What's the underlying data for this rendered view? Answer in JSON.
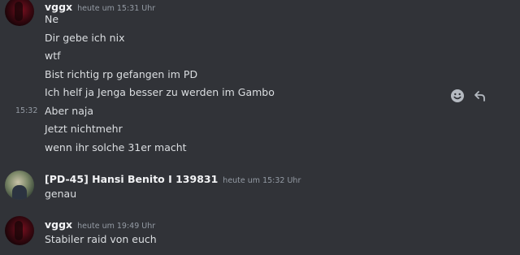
{
  "groups": [
    {
      "username": "vggx",
      "timestamp": "heute um 15:31 Uhr",
      "messages": [
        "Ne",
        "Dir gebe ich nix",
        "wtf",
        "Bist richtig rp gefangen im PD",
        "Ich helf ja Jenga besser zu werden im Gambo",
        "Aber naja",
        "Jetzt nichtmehr",
        "wenn ihr solche 31er macht"
      ],
      "hover_timestamp": "15:32"
    },
    {
      "username": "[PD-45] Hansi Benito I 139831",
      "timestamp": "heute um 15:32 Uhr",
      "messages": [
        "genau"
      ]
    },
    {
      "username": "vggx",
      "timestamp": "heute um 19:49 Uhr",
      "messages": [
        "Stabiler raid von euch"
      ]
    }
  ],
  "colors": {
    "background": "#313338",
    "text": "#dbdee1",
    "username": "#f2f3f5",
    "timestamp": "#949ba4"
  },
  "icons": {
    "add_reaction": "emoji-smile-icon",
    "reply": "reply-arrow-icon"
  }
}
